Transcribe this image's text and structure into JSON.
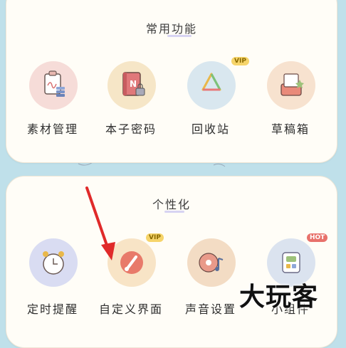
{
  "sections": [
    {
      "title": "常用功能",
      "items": [
        {
          "label": "素材管理",
          "icon": "material-clipboard-icon",
          "bg": "#f6dcd8"
        },
        {
          "label": "本子密码",
          "icon": "notebook-lock-icon",
          "bg": "#f6e6c7",
          "inner": "N"
        },
        {
          "label": "回收站",
          "icon": "recycle-icon",
          "bg": "#d9e7ef",
          "badge": "VIP"
        },
        {
          "label": "草稿箱",
          "icon": "draft-box-icon",
          "bg": "#f7e2cf"
        }
      ]
    },
    {
      "title": "个性化",
      "items": [
        {
          "label": "定时提醒",
          "icon": "alarm-clock-icon",
          "bg": "#d9dcf2"
        },
        {
          "label": "自定义界面",
          "icon": "paint-brush-icon",
          "bg": "#f8e4c6",
          "badge": "VIP"
        },
        {
          "label": "声音设置",
          "icon": "music-disc-icon",
          "bg": "#f3dcc4"
        },
        {
          "label": "小组件",
          "icon": "widget-icon",
          "bg": "#dbe3ef",
          "badge": "HOT"
        }
      ]
    }
  ],
  "watermark": "大玩客",
  "colors": {
    "background": "#bfe0ea",
    "card": "#fffdf7",
    "arrow": "#e02a2a"
  }
}
